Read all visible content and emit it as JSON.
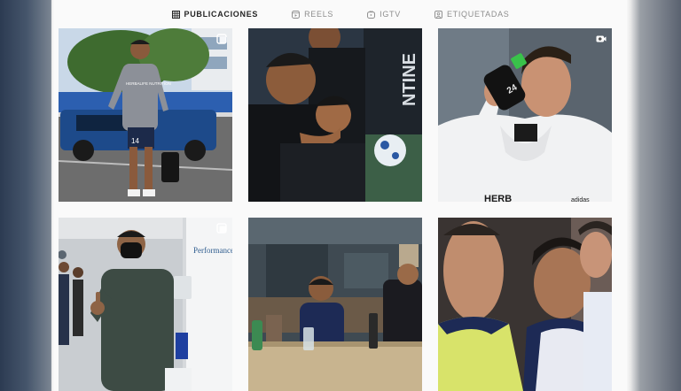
{
  "tabs": [
    {
      "label": "PUBLICACIONES",
      "icon": "grid-icon",
      "active": true
    },
    {
      "label": "REELS",
      "icon": "reels-icon",
      "active": false
    },
    {
      "label": "IGTV",
      "icon": "igtv-icon",
      "active": false
    },
    {
      "label": "ETIQUETADAS",
      "icon": "tagged-icon",
      "active": false
    }
  ],
  "posts": [
    {
      "id": "post-1",
      "badge": "carousel-icon",
      "shirt_text": "HERBALIFE NUTRITION",
      "number": "14"
    },
    {
      "id": "post-2",
      "badge": "",
      "wall_text": "NTINE"
    },
    {
      "id": "post-3",
      "badge": "video-icon",
      "hoodie_text": "HERB",
      "brand": "adidas",
      "bottle_text": "24"
    },
    {
      "id": "post-4",
      "badge": "carousel-icon",
      "sign_text": "Performance Therapy"
    },
    {
      "id": "post-5",
      "badge": ""
    },
    {
      "id": "post-6",
      "badge": ""
    }
  ],
  "colors": {
    "active_tab": "#262626",
    "inactive_tab": "#8e8e8e"
  }
}
